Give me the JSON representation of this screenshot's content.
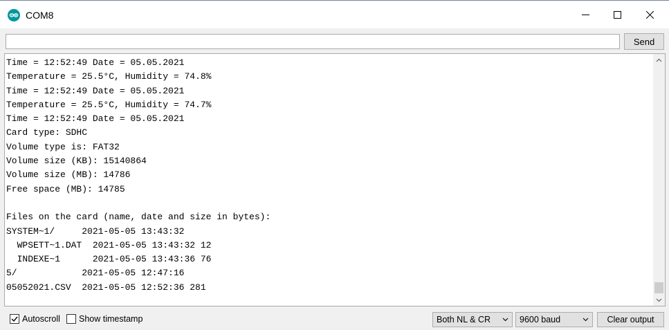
{
  "window": {
    "title": "COM8",
    "icon": "arduino-icon"
  },
  "input_row": {
    "input_value": "",
    "send_label": "Send"
  },
  "output": {
    "lines": [
      "Time = 12:52:49 Date = 05.05.2021",
      "Temperature = 25.5°C, Humidity = 74.8%",
      "Time = 12:52:49 Date = 05.05.2021",
      "Temperature = 25.5°C, Humidity = 74.7%",
      "Time = 12:52:49 Date = 05.05.2021",
      "Card type: SDHC",
      "Volume type is: FAT32",
      "Volume size (KB): 15140864",
      "Volume size (MB): 14786",
      "Free space (MB): 14785",
      "",
      "Files on the card (name, date and size in bytes):",
      "SYSTEM~1/     2021-05-05 13:43:32",
      "  WPSETT~1.DAT  2021-05-05 13:43:32 12",
      "  INDEXE~1      2021-05-05 13:43:36 76",
      "5/            2021-05-05 12:47:16",
      "05052021.CSV  2021-05-05 12:52:36 281"
    ]
  },
  "status_bar": {
    "autoscroll_label": "Autoscroll",
    "autoscroll_checked": true,
    "timestamp_label": "Show timestamp",
    "timestamp_checked": false,
    "line_ending": "Both NL & CR",
    "baud_rate": "9600 baud",
    "clear_label": "Clear output"
  },
  "colors": {
    "arduino_teal": "#00979c",
    "window_bg": "#f0f0f0",
    "output_bg": "#ffffff"
  }
}
